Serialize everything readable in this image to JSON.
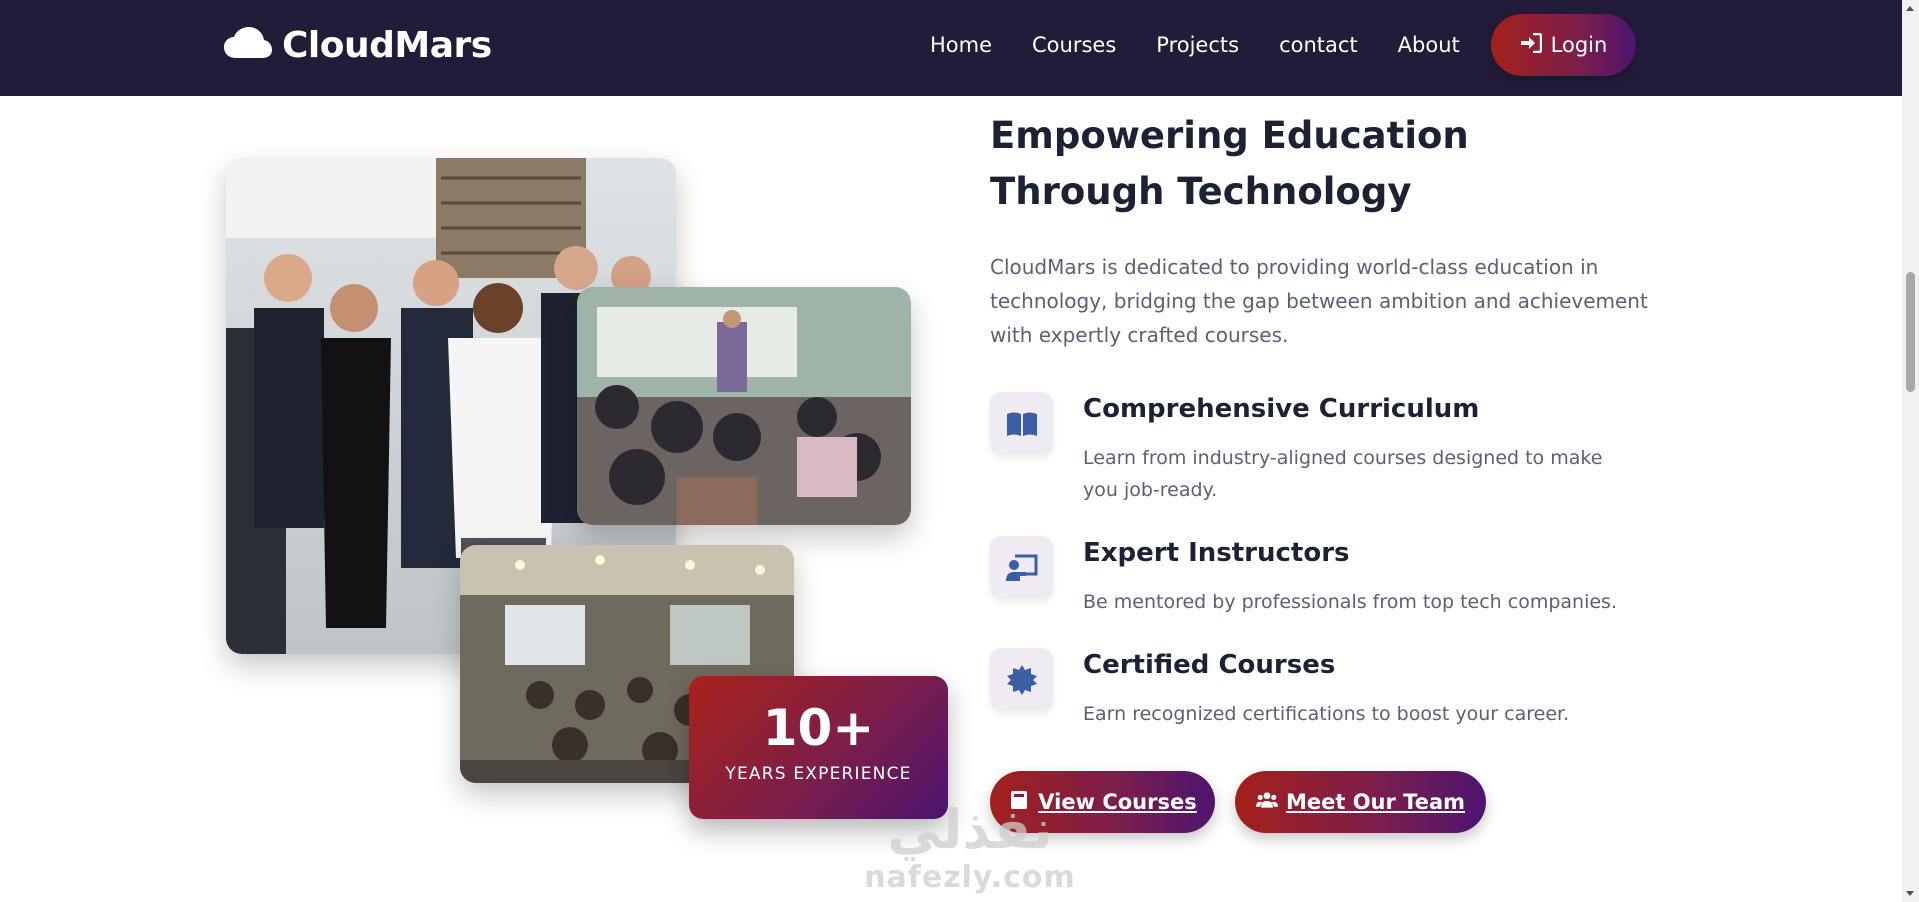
{
  "header": {
    "brand": "CloudMars",
    "brand_icon": "cloud-icon",
    "nav": [
      "Home",
      "Courses",
      "Projects",
      "contact",
      "About"
    ],
    "login_label": "Login",
    "login_icon": "sign-in-icon"
  },
  "colors": {
    "header_bg": "#221c3a",
    "accent_red": "#a3201b",
    "accent_purple": "#4d1470",
    "icon_blue": "#3b5ea6"
  },
  "hero": {
    "title": "Empowering Education Through Technology",
    "description": "CloudMars is dedicated to providing world-class education in technology, bridging the gap between ambition and achievement with expertly crafted courses."
  },
  "experience": {
    "number": "10+",
    "label": "YEARS EXPERIENCE"
  },
  "features": [
    {
      "icon": "book-open-icon",
      "title": "Comprehensive Curriculum",
      "description": "Learn from industry-aligned courses designed to make you job-ready."
    },
    {
      "icon": "chalkboard-teacher-icon",
      "title": "Expert Instructors",
      "description": "Be mentored by professionals from top tech companies."
    },
    {
      "icon": "certificate-icon",
      "title": "Certified Courses",
      "description": "Earn recognized certifications to boost your career."
    }
  ],
  "buttons": {
    "view_courses": "View Courses",
    "view_courses_icon": "book-icon",
    "meet_team": "Meet Our Team",
    "meet_team_icon": "users-icon"
  },
  "watermark": {
    "arabic": "نفذلي",
    "latin": "nafezly.com"
  }
}
